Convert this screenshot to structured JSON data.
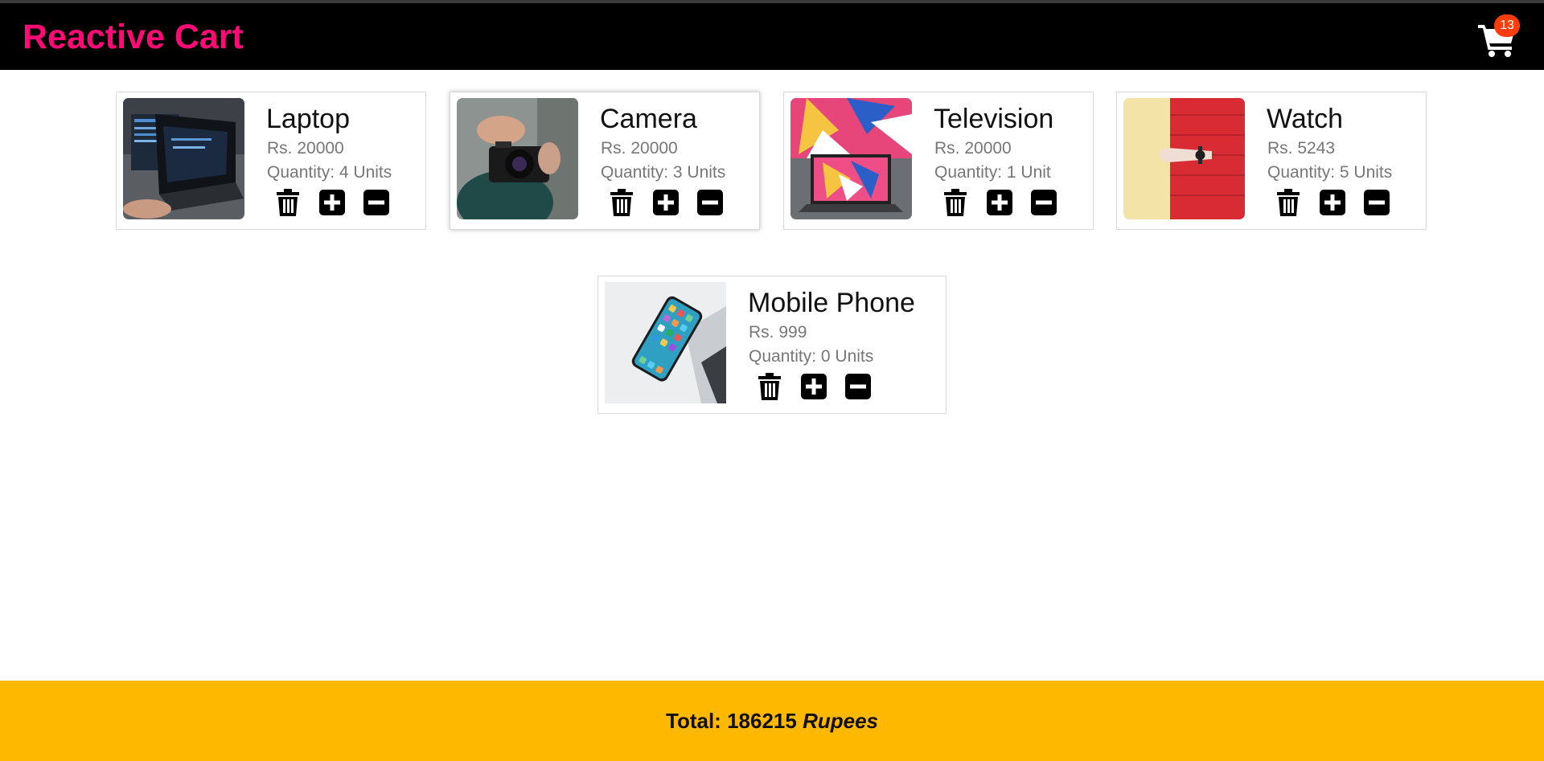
{
  "navbar": {
    "brand": "Reactive Cart",
    "cart_count": "13",
    "cart_icon": "shopping-cart-icon"
  },
  "products": [
    {
      "title": "Laptop",
      "price": "Rs. 20000",
      "quantity_label": "Quantity:",
      "quantity": "4",
      "unit": "Units",
      "image": "laptop-photo"
    },
    {
      "title": "Camera",
      "price": "Rs. 20000",
      "quantity_label": "Quantity:",
      "quantity": "3",
      "unit": "Units",
      "image": "camera-photo"
    },
    {
      "title": "Television",
      "price": "Rs. 20000",
      "quantity_label": "Quantity:",
      "quantity": "1",
      "unit": "Unit",
      "image": "television-photo"
    },
    {
      "title": "Watch",
      "price": "Rs. 5243",
      "quantity_label": "Quantity:",
      "quantity": "5",
      "unit": "Units",
      "image": "watch-photo"
    },
    {
      "title": "Mobile Phone",
      "price": "Rs. 999",
      "quantity_label": "Quantity:",
      "quantity": "0",
      "unit": "Units",
      "image": "mobile-phone-photo"
    }
  ],
  "footer": {
    "total_label": "Total:",
    "total_value": "186215",
    "currency": "Rupees"
  },
  "colors": {
    "navbar_bg": "#000000",
    "brand": "#ff0a76",
    "badge": "#ff3d0a",
    "footer_bg": "#ffb800"
  },
  "icons": [
    "trash-icon",
    "plus-square-icon",
    "minus-square-icon"
  ]
}
